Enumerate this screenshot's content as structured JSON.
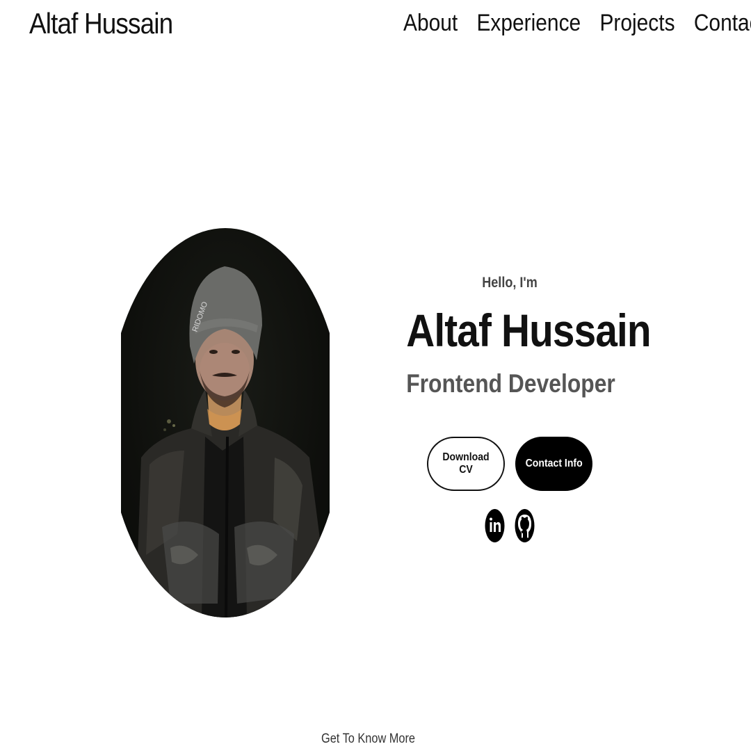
{
  "nav": {
    "logo": "Altaf Hussain",
    "links": [
      "About",
      "Experience",
      "Projects",
      "Contact"
    ]
  },
  "profile": {
    "image_alt": "Altaf Hussain profile picture",
    "beanie_text": "RIDOMO"
  },
  "hero": {
    "greeting": "Hello, I'm",
    "name": "Altaf Hussain",
    "role": "Frontend Developer",
    "buttons": {
      "download_cv": "Download CV",
      "contact_info": "Contact Info"
    },
    "socials": {
      "linkedin_icon": "linkedin-icon",
      "github_icon": "github-icon"
    }
  },
  "footer_prompt": "Get To Know More",
  "colors": {
    "text": "#111111",
    "muted": "#555555",
    "button_solid": "#000000",
    "background": "#ffffff"
  }
}
